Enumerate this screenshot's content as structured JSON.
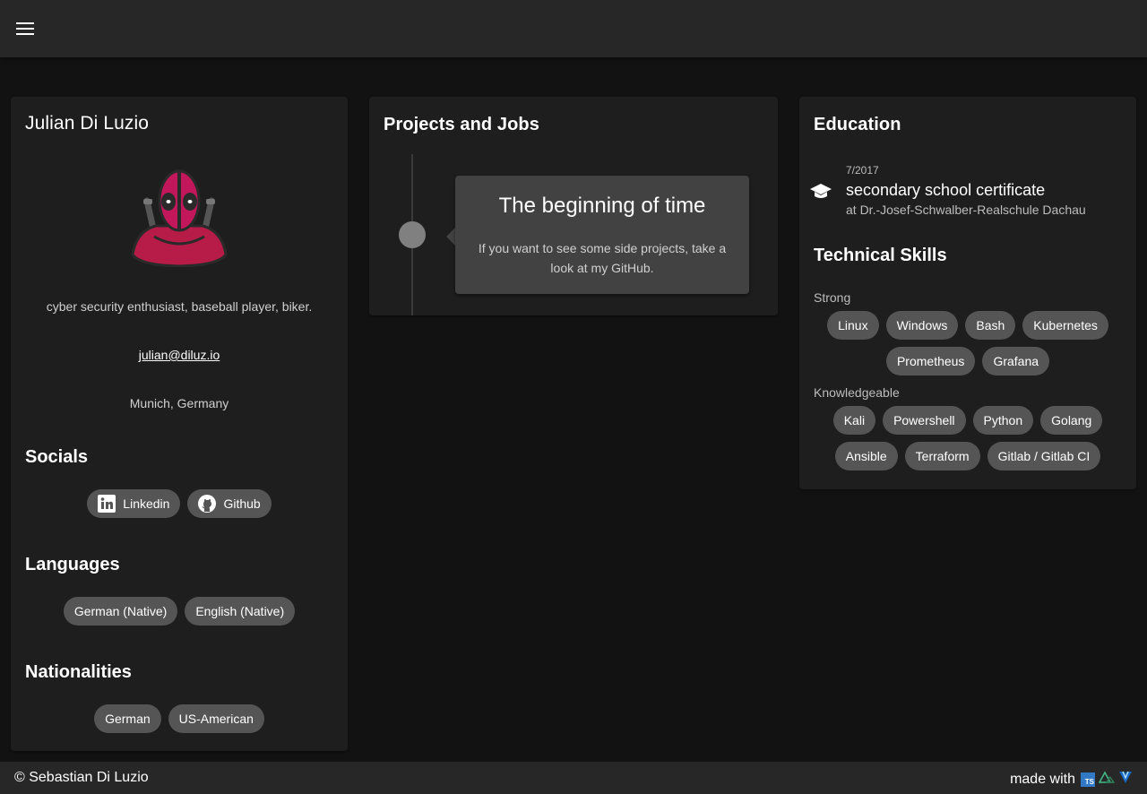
{
  "colors": {
    "background": "#121212",
    "card": "#1e1e1e",
    "appbar": "#272727",
    "chip": "#555555",
    "avatar_accent": "#c2185b"
  },
  "appbar": {
    "menu_icon": "menu-icon"
  },
  "profile": {
    "name": "Julian Di Luzio",
    "tagline": "cyber security enthusiast, baseball player, biker.",
    "email": "julian@diluz.io",
    "location": "Munich, Germany",
    "socials_title": "Socials",
    "socials": [
      {
        "label": "Linkedin",
        "icon": "linkedin-icon"
      },
      {
        "label": "Github",
        "icon": "github-icon"
      }
    ],
    "languages_title": "Languages",
    "languages": [
      "German (Native)",
      "English (Native)"
    ],
    "nationalities_title": "Nationalities",
    "nationalities": [
      "German",
      "US-American"
    ]
  },
  "projects": {
    "title": "Projects and Jobs",
    "timeline": [
      {
        "title": "The beginning of time",
        "text": "If you want to see some side projects, take a look at my GitHub."
      }
    ]
  },
  "education": {
    "title": "Education",
    "items": [
      {
        "date": "7/2017",
        "title": "secondary school certificate",
        "school": "at Dr.-Josef-Schwalber-Realschule Dachau",
        "icon": "graduation-cap-icon"
      }
    ]
  },
  "skills": {
    "title": "Technical Skills",
    "strong_label": "Strong",
    "strong_row1": [
      "Linux",
      "Windows",
      "Bash",
      "Kubernetes"
    ],
    "strong_row2": [
      "Prometheus",
      "Grafana"
    ],
    "knowledgeable_label": "Knowledgeable",
    "knowledgeable_row1": [
      "Kali",
      "Powershell",
      "Python",
      "Golang"
    ],
    "knowledgeable_row2": [
      "Ansible",
      "Terraform",
      "Gitlab / Gitlab CI"
    ]
  },
  "footer": {
    "copyright": "© Sebastian Di Luzio",
    "made_with": "made with",
    "tech_icons": [
      "typescript-icon",
      "nuxt-icon",
      "vuetify-icon"
    ],
    "ts_badge": "TS"
  }
}
